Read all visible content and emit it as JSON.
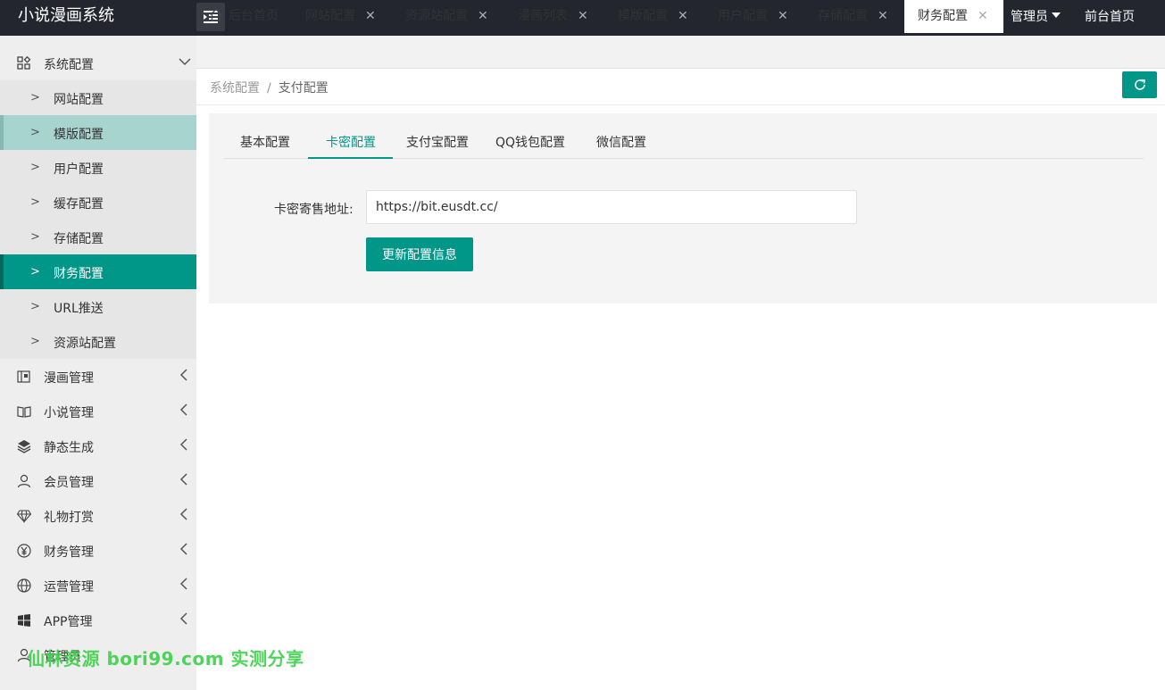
{
  "header": {
    "brand": "小说漫画系统",
    "admin_label": "管理员",
    "front_link": "前台首页"
  },
  "sidebar": {
    "system_group": "系统配置",
    "sub_items": [
      "网站配置",
      "模版配置",
      "用户配置",
      "缓存配置",
      "存储配置",
      "财务配置",
      "URL推送",
      "资源站配置"
    ],
    "groups": [
      {
        "label": "漫画管理",
        "icon": "comic-icon"
      },
      {
        "label": "小说管理",
        "icon": "book-icon"
      },
      {
        "label": "静态生成",
        "icon": "layers-icon"
      },
      {
        "label": "会员管理",
        "icon": "user-icon"
      },
      {
        "label": "礼物打赏",
        "icon": "diamond-icon"
      },
      {
        "label": "财务管理",
        "icon": "yen-icon"
      },
      {
        "label": "运营管理",
        "icon": "globe-icon"
      },
      {
        "label": "APP管理",
        "icon": "windows-icon"
      },
      {
        "label": "管理员",
        "icon": "person-icon"
      }
    ]
  },
  "tabs": [
    {
      "label": "后台首页",
      "closable": false
    },
    {
      "label": "网站配置",
      "closable": true
    },
    {
      "label": "资源站配置",
      "closable": true
    },
    {
      "label": "漫画列表",
      "closable": true
    },
    {
      "label": "模版配置",
      "closable": true
    },
    {
      "label": "用户配置",
      "closable": true
    },
    {
      "label": "存储配置",
      "closable": true
    },
    {
      "label": "财务配置",
      "closable": true
    }
  ],
  "breadcrumb": {
    "parent": "系统配置",
    "separator": "/",
    "current": "支付配置"
  },
  "subtabs": [
    "基本配置",
    "卡密配置",
    "支付宝配置",
    "QQ钱包配置",
    "微信配置"
  ],
  "form": {
    "label": "卡密寄售地址:",
    "value": "https://bit.eusdt.cc/",
    "submit": "更新配置信息"
  },
  "watermark": "仙林资源 bori99.com 实测分享",
  "colors": {
    "accent": "#009688",
    "header_bg": "#23262e",
    "sidebar_bg": "#eeeeee"
  }
}
